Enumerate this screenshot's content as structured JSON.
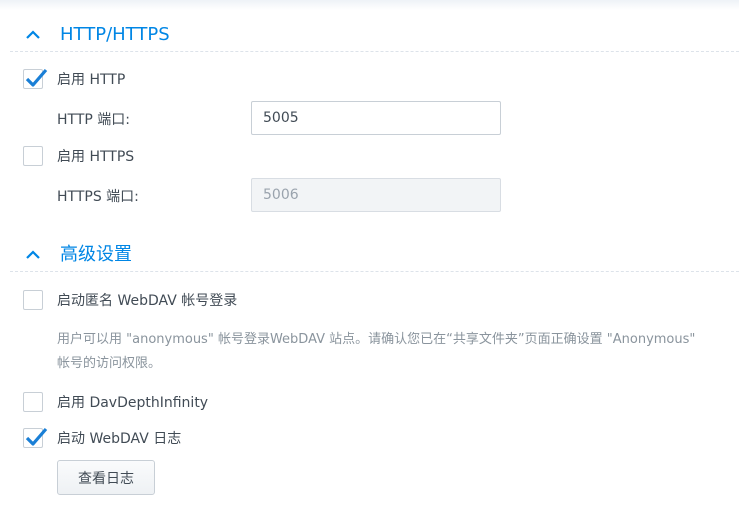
{
  "colors": {
    "accent": "#0086e5",
    "text": "#414b55",
    "muted": "#8a949d",
    "check": "#1a7fd6"
  },
  "http_section": {
    "title": "HTTP/HTTPS",
    "enable_http": {
      "label": "启用 HTTP",
      "checked": true
    },
    "http_port": {
      "label": "HTTP 端口:",
      "value": "5005"
    },
    "enable_https": {
      "label": "启用 HTTPS",
      "checked": false
    },
    "https_port": {
      "label": "HTTPS 端口:",
      "value": "5006",
      "disabled": true
    }
  },
  "advanced_section": {
    "title": "高级设置",
    "anonymous_login": {
      "label": "启动匿名 WebDAV 帐号登录",
      "checked": false
    },
    "anonymous_desc_line1": "用户可以用 \"anonymous\" 帐号登录WebDAV 站点。请确认您已在“共享文件夹”页面正确设置 \"Anonymous\"",
    "anonymous_desc_line2": "帐号的访问权限。",
    "dav_depth_infinity": {
      "label": "启用 DavDepthInfinity",
      "checked": false
    },
    "webdav_log": {
      "label": "启动 WebDAV 日志",
      "checked": true
    },
    "view_log_button": "查看日志"
  }
}
